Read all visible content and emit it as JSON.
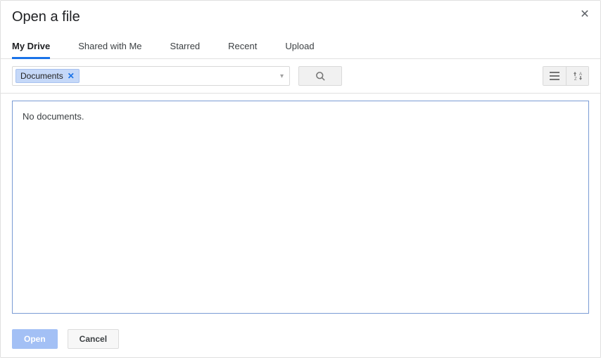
{
  "dialog": {
    "title": "Open a file"
  },
  "tabs": [
    {
      "label": "My Drive",
      "active": true
    },
    {
      "label": "Shared with Me",
      "active": false
    },
    {
      "label": "Starred",
      "active": false
    },
    {
      "label": "Recent",
      "active": false
    },
    {
      "label": "Upload",
      "active": false
    }
  ],
  "breadcrumb": {
    "chip_label": "Documents"
  },
  "content": {
    "empty_message": "No documents."
  },
  "footer": {
    "open_label": "Open",
    "cancel_label": "Cancel"
  }
}
